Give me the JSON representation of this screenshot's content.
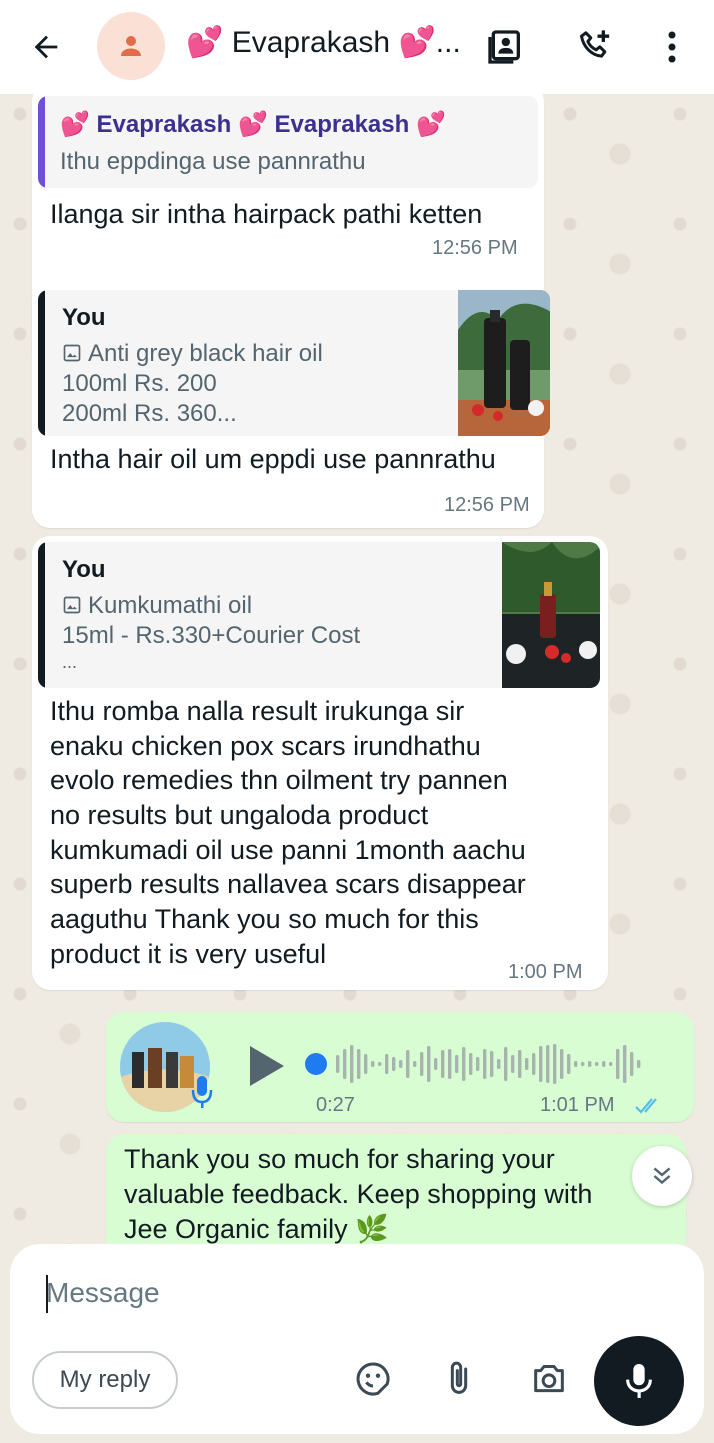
{
  "header": {
    "title": "💕 Evaprakash 💕...",
    "icons": [
      "back-arrow-icon",
      "contact-avatar-icon",
      "contact-card-icon",
      "add-call-icon",
      "more-vert-icon"
    ]
  },
  "messages": [
    {
      "direction": "in",
      "quote": {
        "name": "💕 Evaprakash 💕 Evaprakash 💕",
        "lines": [
          "Ithu eppdinga use pannrathu"
        ]
      },
      "text": "Ilanga sir intha hairpack pathi ketten",
      "time": "12:56 PM"
    },
    {
      "direction": "in",
      "quote": {
        "name": "You",
        "lines": [
          "Anti grey black hair oil",
          "100ml Rs. 200",
          "200ml Rs. 360..."
        ],
        "has_image": true
      },
      "text": "Intha hair oil um eppdi use pannrathu",
      "time": "12:56 PM"
    },
    {
      "direction": "in",
      "quote": {
        "name": "You",
        "lines": [
          "Kumkumathi oil",
          "15ml - Rs.330+Courier Cost",
          "..."
        ],
        "has_image": true
      },
      "text_lines": [
        "Ithu romba nalla result irukunga sir",
        "enaku chicken pox scars irundhathu",
        "evolo remedies thn oilment try pannen",
        "no results but ungaloda product",
        "kumkumadi oil use panni 1month aachu",
        "superb results nallavea scars disappear",
        "aaguthu Thank you so much for this",
        "product it is very useful"
      ],
      "time": "1:00 PM"
    },
    {
      "direction": "out",
      "voice": {
        "duration": "0:27"
      },
      "time": "1:01 PM",
      "status": "read"
    },
    {
      "direction": "out",
      "text_lines": [
        "Thank you so much for sharing your",
        "valuable feedback. Keep shopping with",
        "Jee Organic family 🌿"
      ]
    }
  ],
  "composer": {
    "placeholder": "Message",
    "value": "",
    "my_reply_label": "My reply"
  },
  "colors": {
    "wallpaper": "#efeae2",
    "incoming": "#ffffff",
    "outgoing": "#d9fdd3",
    "quote_bar_contact": "#6f4fd6",
    "quote_name_contact": "#3b2f8f",
    "tick_read": "#53bdeb",
    "voice_dot": "#1f7cf0"
  }
}
